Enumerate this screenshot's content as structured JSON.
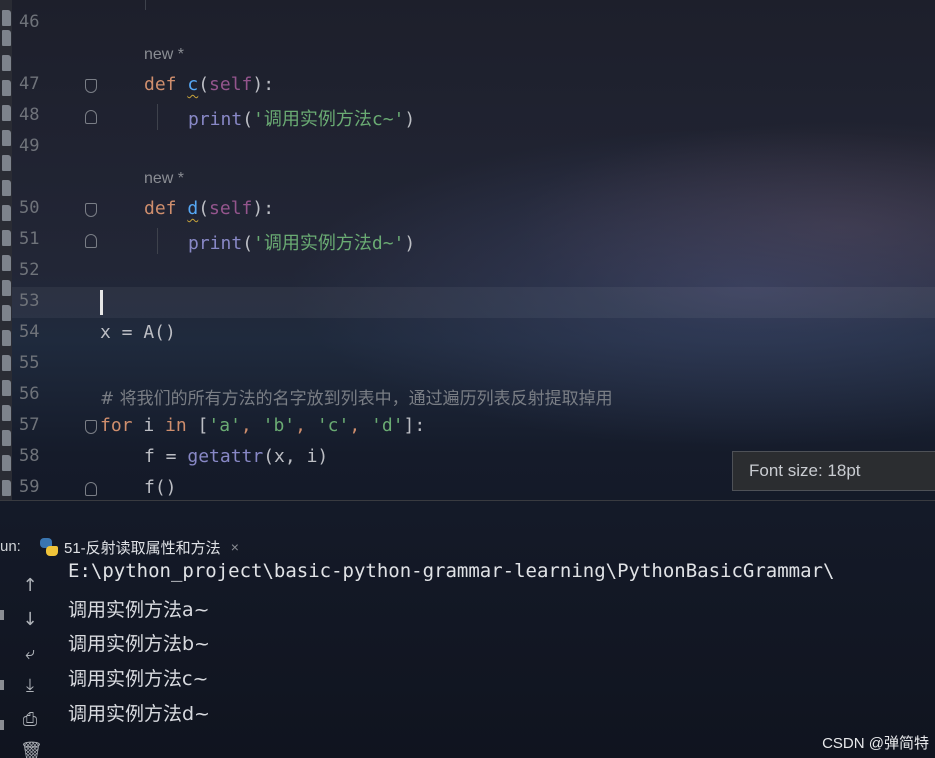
{
  "editor": {
    "line_numbers": [
      "46",
      "47",
      "48",
      "49",
      "50",
      "51",
      "52",
      "53",
      "54",
      "55",
      "56",
      "57",
      "58",
      "59"
    ],
    "inlay_hint_c": "new *",
    "inlay_hint_d": "new *",
    "lines": {
      "l47": {
        "kw": "def",
        "name": "c",
        "open": "(",
        "self": "self",
        "close": "):"
      },
      "l48": {
        "fn": "print",
        "open": "(",
        "str": "'调用实例方法c~'",
        "close": ")"
      },
      "l50": {
        "kw": "def",
        "name": "d",
        "open": "(",
        "self": "self",
        "close": "):"
      },
      "l51": {
        "fn": "print",
        "open": "(",
        "str": "'调用实例方法d~'",
        "close": ")"
      },
      "l54": "x = A()",
      "l56": "# 将我们的所有方法的名字放到列表中，通过遍历列表反射提取掉用",
      "l57": {
        "kw1": "for",
        "mid1": " i ",
        "kw2": "in",
        "mid2": " [",
        "s1": "'a'",
        "c1": ", ",
        "s2": "'b'",
        "c2": ", ",
        "s3": "'c'",
        "c3": ", ",
        "s4": "'d'",
        "end": "]:"
      },
      "l58": {
        "pre": "f = ",
        "fn": "getattr",
        "args": "(x, i)"
      },
      "l59": "f()"
    }
  },
  "tooltip": {
    "text": "Font size: 18pt"
  },
  "run_panel": {
    "label": "un:",
    "tab_title": "51-反射读取属性和方法",
    "tab_close": "×",
    "output": [
      "E:\\python_project\\basic-python-grammar-learning\\PythonBasicGrammar\\",
      "调用实例方法a~",
      "调用实例方法b~",
      "调用实例方法c~",
      "调用实例方法d~"
    ]
  },
  "watermark": "CSDN @弹简特",
  "colors": {
    "keyword": "#cf8e6d",
    "function": "#56a8f5",
    "self": "#94558d",
    "string": "#6aab73",
    "builtin": "#8888c6",
    "comment": "#7a7e85"
  }
}
